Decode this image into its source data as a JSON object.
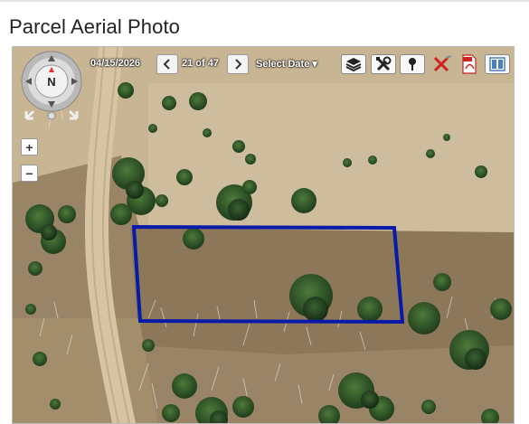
{
  "page": {
    "title": "Parcel Aerial Photo"
  },
  "map": {
    "date": "04/15/2026",
    "prev_icon": "chevron-left-icon",
    "next_icon": "chevron-right-icon",
    "counter": "21 of 47",
    "select_date_label": "Select Date",
    "select_date_caret": "▾",
    "compass_north": "N",
    "zoom_in": "+",
    "zoom_out": "−",
    "tools": [
      "layers-icon",
      "tools-icon",
      "pin-icon",
      "clear-icon",
      "pdf-icon",
      "split-view-icon"
    ],
    "parcel_outline_color": "#0a1aa8"
  }
}
